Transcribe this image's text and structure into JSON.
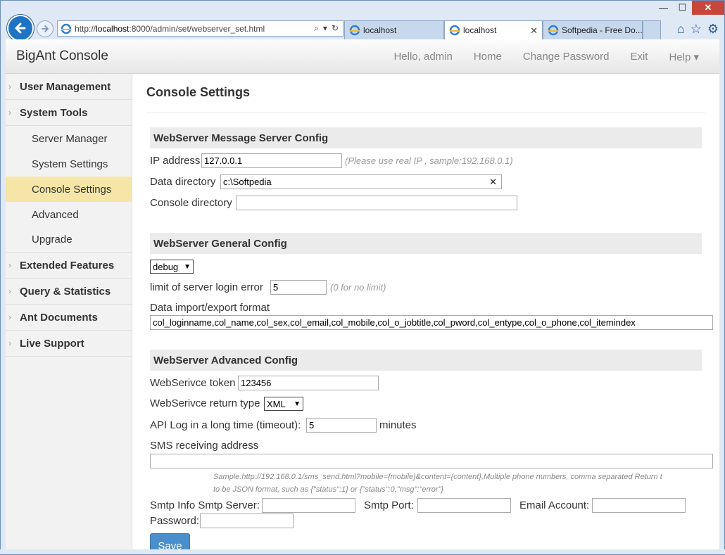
{
  "browser": {
    "url_prefix": "http://",
    "url_host": "localhost",
    "url_rest": ":8000/admin/set/webserver_set.html",
    "tabs": [
      {
        "label": "localhost",
        "active": false
      },
      {
        "label": "localhost",
        "active": true
      },
      {
        "label": "Softpedia - Free Do...",
        "active": false
      }
    ],
    "tab_close": "✕",
    "window_controls": {
      "minimize": "—",
      "maximize": "☐",
      "close": "✕"
    }
  },
  "navbar": {
    "brand": "BigAnt Console",
    "links": [
      "Hello, admin",
      "Home",
      "Change Password",
      "Exit",
      "Help ▾"
    ]
  },
  "sidebar": {
    "items": [
      {
        "label": "User Management"
      },
      {
        "label": "System Tools"
      },
      {
        "label": "Extended Features"
      },
      {
        "label": "Query & Statistics"
      },
      {
        "label": "Ant Documents"
      },
      {
        "label": "Live Support"
      }
    ],
    "subitems": [
      "Server Manager",
      "System Settings",
      "Console Settings",
      "Advanced",
      "Upgrade"
    ],
    "active_subitem": "Console Settings"
  },
  "main": {
    "title": "Console Settings",
    "message_server": {
      "heading": "WebServer Message Server Config",
      "ip_label": "IP address",
      "ip_value": "127.0.0.1",
      "ip_hint": "(Please use real IP , sample:192.168.0.1)",
      "data_dir_label": "Data directory",
      "data_dir_value": "c:\\Softpedia",
      "console_dir_label": "Console directory",
      "console_dir_value": ""
    },
    "general": {
      "heading": "WebServer General Config",
      "mode_value": "debug",
      "limit_label": "limit of server login error",
      "limit_value": "5",
      "limit_hint": "(0 for no limit)",
      "format_label": "Data import/export format",
      "format_value": "col_loginname,col_name,col_sex,col_email,col_mobile,col_o_jobtitle,col_pword,col_entype,col_o_phone,col_itemindex"
    },
    "advanced": {
      "heading": "WebServer Advanced Config",
      "token_label": "WebSerivce token",
      "token_value": "123456",
      "return_type_label": "WebSerivce return type",
      "return_type_value": "XML",
      "api_log_label": "API Log in a long time (timeout):",
      "api_log_value": "5",
      "api_log_unit": "minutes",
      "sms_label": "SMS receiving address",
      "sms_value": "",
      "sms_sample_line1": "Sample:http://192.168.0.1/sms_send.html?mobile={mobile}&content={content},Multiple phone numbers, comma separated Return t",
      "sms_sample_line2": "to be JSON format, such as {\"status\":1} or {\"status\":0,\"msg\":\"error\"}",
      "smtp_server_label": "Smtp Info Smtp Server:",
      "smtp_port_label": "Smtp Port:",
      "email_account_label": "Email Account:",
      "password_label": "Password:"
    },
    "save_label": "Save"
  }
}
